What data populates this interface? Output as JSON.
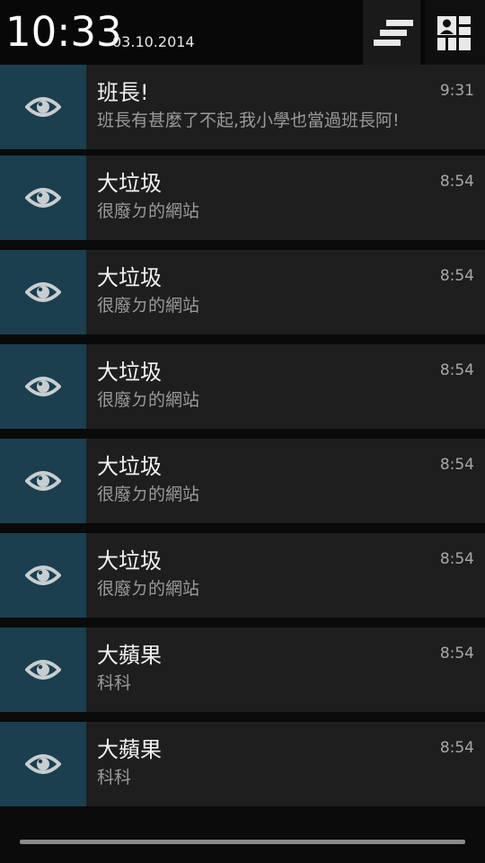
{
  "header": {
    "time": "10:33",
    "date": "03.10.2014",
    "clear_all_icon": "clear-all-icon",
    "quick_settings_icon": "quick-settings-icon"
  },
  "notifications": [
    {
      "title": "班長!",
      "text": "班長有甚麼了不起,我小學也當過班長阿!",
      "time": "9:31",
      "icon": "eye-icon"
    },
    {
      "title": "大垃圾",
      "text": "很廢ㄉ的網站",
      "time": "8:54",
      "icon": "eye-icon"
    },
    {
      "title": "大垃圾",
      "text": "很廢ㄉ的網站",
      "time": "8:54",
      "icon": "eye-icon"
    },
    {
      "title": "大垃圾",
      "text": "很廢ㄉ的網站",
      "time": "8:54",
      "icon": "eye-icon"
    },
    {
      "title": "大垃圾",
      "text": "很廢ㄉ的網站",
      "time": "8:54",
      "icon": "eye-icon"
    },
    {
      "title": "大垃圾",
      "text": "很廢ㄉ的網站",
      "time": "8:54",
      "icon": "eye-icon"
    },
    {
      "title": "大蘋果",
      "text": "科科",
      "time": "8:54",
      "icon": "eye-icon"
    },
    {
      "title": "大蘋果",
      "text": "科科",
      "time": "8:54",
      "icon": "eye-icon"
    }
  ],
  "colors": {
    "icon_background": "#1b3f4f",
    "notification_background": "#1e1e1e",
    "eye_icon": "#c8ced0"
  }
}
